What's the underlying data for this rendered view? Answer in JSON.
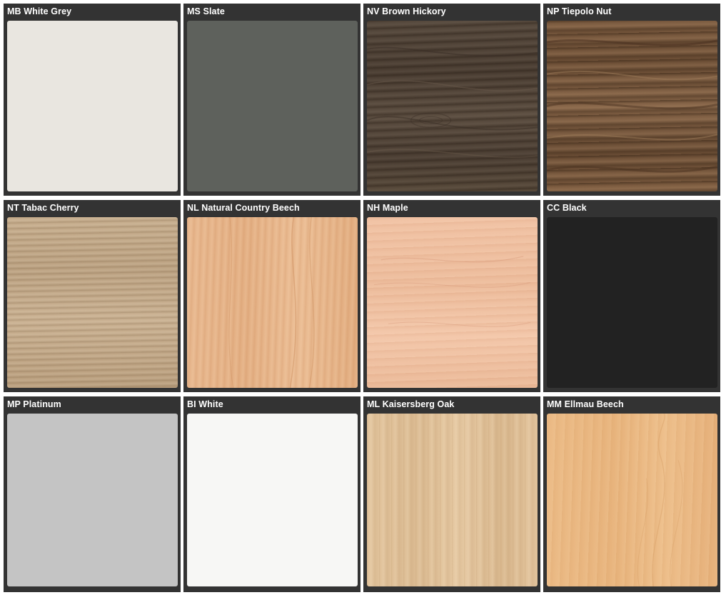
{
  "swatches": [
    {
      "label": "MB White Grey",
      "finish": "solid",
      "color": "#e9e6e0"
    },
    {
      "label": "MS Slate",
      "finish": "solid",
      "color": "#5e615c"
    },
    {
      "label": "NV Brown Hickory",
      "finish": "woodgrain",
      "color": "#50433a"
    },
    {
      "label": "NP Tiepolo Nut",
      "finish": "woodgrain",
      "color": "#775840"
    },
    {
      "label": "NT Tabac Cherry",
      "finish": "woodgrain",
      "color": "#c2a888"
    },
    {
      "label": "NL Natural Country Beech",
      "finish": "woodgrain",
      "color": "#e6b689"
    },
    {
      "label": "NH Maple",
      "finish": "woodgrain",
      "color": "#efc1a2"
    },
    {
      "label": "CC Black",
      "finish": "solid",
      "color": "#222222"
    },
    {
      "label": "MP Platinum",
      "finish": "solid",
      "color": "#c4c4c4"
    },
    {
      "label": "BI White",
      "finish": "solid",
      "color": "#f7f7f5"
    },
    {
      "label": "ML Kaisersberg Oak",
      "finish": "woodgrain",
      "color": "#e0c199"
    },
    {
      "label": "MM Ellmau Beech",
      "finish": "woodgrain",
      "color": "#e9b780"
    }
  ],
  "colors": {
    "tile_background": "#333333",
    "label_text": "#ffffff",
    "page_background": "#ffffff"
  }
}
